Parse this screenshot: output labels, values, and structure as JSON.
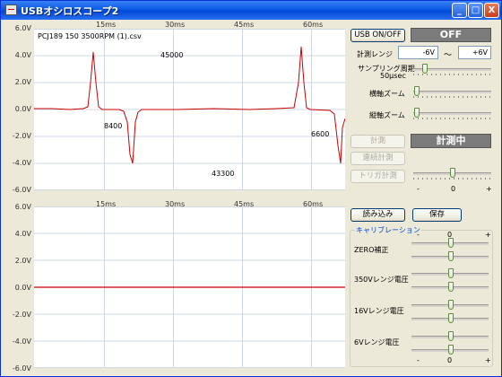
{
  "window": {
    "title": "USBオシロスコープ2"
  },
  "titlebar_buttons": {
    "minimize": "_",
    "maximize": "□",
    "close": "X"
  },
  "top_plot": {
    "file_label": "PCJ189 150  3500RPM (1).csv",
    "y_ticks": [
      "6.0V",
      "4.0V",
      "2.0V",
      "0.0V",
      "-2.0V",
      "-4.0V",
      "-6.0V"
    ],
    "x_ticks": [
      "15ms",
      "30ms",
      "45ms",
      "60ms"
    ],
    "annotations": [
      "45000",
      "8400",
      "6600",
      "43300"
    ],
    "trace_color": "#cc0000"
  },
  "bottom_plot": {
    "y_ticks": [
      "6.0V",
      "4.0V",
      "2.0V",
      "0.0V",
      "-2.0V",
      "-4.0V",
      "-6.0V"
    ],
    "x_ticks": [
      "15ms",
      "30ms",
      "45ms",
      "60ms"
    ],
    "trace_color": "#cc0000"
  },
  "controls": {
    "usb_button": "USB ON/OFF",
    "usb_state": "OFF",
    "range_label": "計測レンジ",
    "range_min": "-6V",
    "range_tilde": "〜",
    "range_max": "+6V",
    "sampling_label": "サンプリング周期",
    "sampling_value": "50μsec",
    "hzoom_label": "横軸ズーム",
    "vzoom_label": "縦軸ズーム",
    "measure_button": "計測",
    "measure_state": "計測中",
    "continuous_button": "連続計測",
    "trigger_button": "トリガ計測",
    "trigger_minus": "-",
    "trigger_zero": "0",
    "trigger_plus": "+",
    "load_button": "読み込み",
    "save_button": "保存"
  },
  "calibration": {
    "title": "キャリブレーション",
    "scale_minus": "-",
    "scale_zero": "0",
    "scale_plus": "+",
    "zero_label": "ZERO補正",
    "v350_label": "350Vレンジ電圧",
    "v16_label": "16Vレンジ電圧",
    "v6_label": "6Vレンジ電圧"
  }
}
